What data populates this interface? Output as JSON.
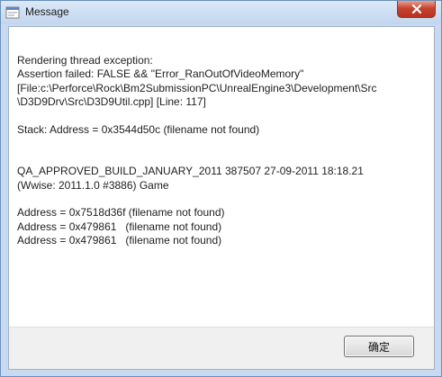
{
  "window": {
    "title": "Message"
  },
  "message": {
    "lines": [
      "Rendering thread exception:",
      "Assertion failed: FALSE && \"Error_RanOutOfVideoMemory\"",
      "[File:c:\\Perforce\\Rock\\Bm2SubmissionPC\\UnrealEngine3\\Development\\Src",
      "\\D3D9Drv\\Src\\D3D9Util.cpp] [Line: 117]",
      "",
      "Stack: Address = 0x3544d50c (filename not found)",
      "",
      "",
      "QA_APPROVED_BUILD_JANUARY_2011 387507 27-09-2011 18:18.21",
      "(Wwise: 2011.1.0 #3886) Game",
      "",
      "Address = 0x7518d36f (filename not found)",
      "Address = 0x479861   (filename not found)",
      "Address = 0x479861   (filename not found)"
    ]
  },
  "buttons": {
    "ok_label": "确定"
  },
  "icons": {
    "app": "message-app-icon",
    "close": "close-icon"
  },
  "colors": {
    "title_bar": "#c9daf0",
    "close_button": "#c7432f",
    "footer": "#f0f0f0"
  }
}
